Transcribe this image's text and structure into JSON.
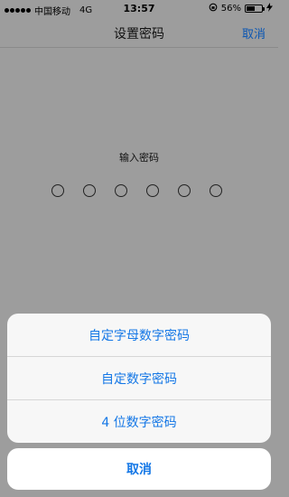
{
  "status_bar": {
    "carrier": "中国移动",
    "network": "4G",
    "time": "13:57",
    "battery_percent": "56%",
    "battery_level": 0.56
  },
  "nav": {
    "title": "设置密码",
    "cancel_label": "取消"
  },
  "prompt": "输入密码",
  "passcode_dots": 6,
  "action_sheet": {
    "options": [
      "自定字母数字密码",
      "自定数字密码",
      "4 位数字密码"
    ],
    "cancel_label": "取消"
  },
  "colors": {
    "accent": "#1477e6",
    "overlay": "#9d9d9d"
  }
}
